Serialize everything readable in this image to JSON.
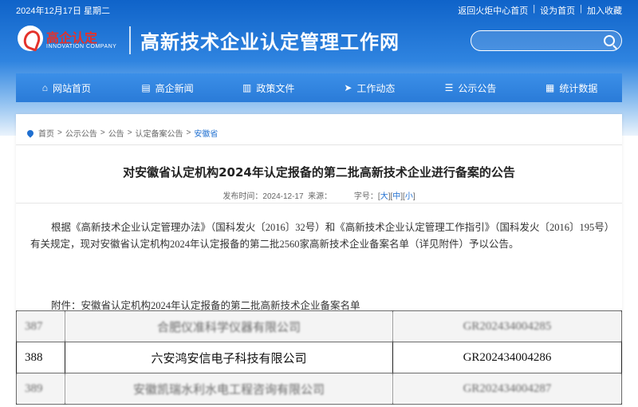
{
  "topbar": {
    "date": "2024年12月17日 星期二",
    "links": [
      "返回火炬中心首页",
      "设为首页",
      "加入收藏"
    ]
  },
  "logo": {
    "name": "高企认定",
    "sub": "INNOVATION COMPANY"
  },
  "site_title": "高新技术企业认定管理工作网",
  "search": {
    "placeholder": ""
  },
  "nav": [
    {
      "label": "网站首页",
      "icon": "home-icon",
      "glyph": "⌂"
    },
    {
      "label": "高企新闻",
      "icon": "news-icon",
      "glyph": "▤"
    },
    {
      "label": "政策文件",
      "icon": "document-icon",
      "glyph": "▥"
    },
    {
      "label": "工作动态",
      "icon": "send-icon",
      "glyph": "➤"
    },
    {
      "label": "公示公告",
      "icon": "notice-icon",
      "glyph": "☰"
    },
    {
      "label": "统计数据",
      "icon": "chart-icon",
      "glyph": "▦"
    }
  ],
  "breadcrumb": [
    "首页",
    "公示公告",
    "公告",
    "认定备案公告",
    "安徽省"
  ],
  "article": {
    "title": "对安徽省认定机构2024年认定报备的第二批高新技术企业进行备案的公告",
    "published_label": "发布时间：",
    "published_date": "2024-12-17",
    "source_label": "来源：",
    "font_label": "字号：",
    "font_sizes": [
      "大",
      "中",
      "小"
    ],
    "body": "根据《高新技术企业认定管理办法》（国科发火〔2016〕32号）和《高新技术企业认定管理工作指引》（国科发火〔2016〕195号）有关规定，现对安徽省认定机构2024年认定报备的第二批2560家高新技术企业备案名单（详见附件）予以公告。",
    "attachment": "附件：安徽省认定机构2024年认定报备的第二批高新技术企业备案名单"
  },
  "table": {
    "rows": [
      {
        "no": "387",
        "company": "合肥仪准科学仪器有限公司",
        "code": "GR202434004285"
      },
      {
        "no": "388",
        "company": "六安鸿安信电子科技有限公司",
        "code": "GR202434004286"
      },
      {
        "no": "389",
        "company": "安徽凯瑞水利水电工程咨询有限公司",
        "code": "GR202434004287"
      }
    ]
  },
  "colors": {
    "brand": "#1f6fd0",
    "nav": "#2a7bd8",
    "logo_red": "#e4322b"
  }
}
